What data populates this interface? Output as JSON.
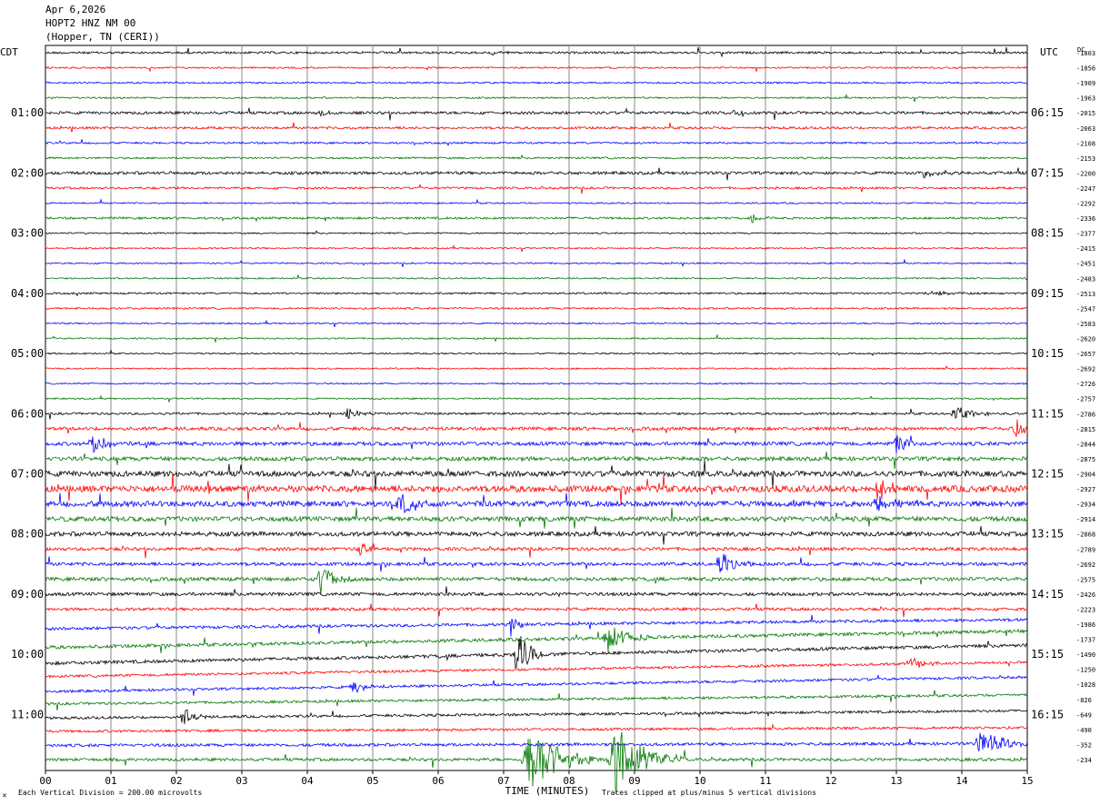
{
  "header": {
    "date": "Apr 6,2026",
    "station": "HOPT2 HNZ NM 00",
    "location": "(Hopper, TN (CERI))"
  },
  "chart_data": {
    "type": "line",
    "title": "",
    "xlabel": "TIME (MINUTES)",
    "ylabel_left": "CDT",
    "ylabel_right": "UTC",
    "dc_label": "DC",
    "x_ticks": [
      "00",
      "01",
      "02",
      "03",
      "04",
      "05",
      "06",
      "07",
      "08",
      "09",
      "10",
      "11",
      "12",
      "13",
      "14",
      "15"
    ],
    "xlim": [
      0,
      15
    ],
    "left_hour_labels": [
      "01:00",
      "02:00",
      "03:00",
      "04:00",
      "05:00",
      "06:00",
      "07:00",
      "08:00",
      "09:00",
      "10:00",
      "11:00"
    ],
    "right_hour_labels": [
      "06:15",
      "07:15",
      "08:15",
      "09:15",
      "10:15",
      "11:15",
      "12:15",
      "13:15",
      "14:15",
      "15:15",
      "16:15"
    ],
    "dc_values": [
      "-1803",
      "-1856",
      "-1909",
      "-1963",
      "-2015",
      "-2063",
      "-2108",
      "-2153",
      "-2200",
      "-2247",
      "-2292",
      "-2336",
      "-2377",
      "-2415",
      "-2451",
      "-2483",
      "-2513",
      "-2547",
      "-2583",
      "-2620",
      "-2657",
      "-2692",
      "-2726",
      "-2757",
      "-2786",
      "-2815",
      "-2844",
      "-2875",
      "-2904",
      "-2927",
      "-2934",
      "-2914",
      "-2868",
      "-2789",
      "-2692",
      "-2575",
      "-2426",
      "-2223",
      "-1986",
      "-1737",
      "-1490",
      "-1250",
      "-1028",
      "-826",
      "-649",
      "-490",
      "-352",
      "-234"
    ],
    "trace_colors": [
      "#000000",
      "#ff0000",
      "#0000ff",
      "#007800"
    ],
    "trace_count": 48,
    "minutes_per_trace": 15,
    "noise_level": [
      1.2,
      0.9,
      0.9,
      0.9,
      1.5,
      1.3,
      1,
      1,
      1.6,
      1.2,
      0.8,
      1.2,
      0.8,
      0.8,
      0.8,
      0.8,
      1,
      1,
      0.8,
      0.8,
      0.8,
      0.8,
      0.8,
      0.8,
      1.2,
      1.8,
      2,
      2.2,
      3,
      3.5,
      3,
      2.6,
      2.4,
      1.8,
      1.8,
      2,
      1.8,
      1.6,
      1.6,
      1.8,
      1.8,
      1.4,
      1.4,
      1.4,
      1.4,
      1.4,
      1.6,
      1.6
    ],
    "drift": [
      0,
      0,
      0,
      0,
      0,
      0,
      0,
      0,
      0,
      0,
      0,
      0,
      0,
      0,
      0,
      0,
      0,
      0,
      0,
      0,
      0,
      0,
      0,
      0,
      0,
      0,
      0,
      0,
      0,
      0,
      0,
      0,
      0,
      0,
      0,
      0,
      0,
      0,
      10,
      18,
      20,
      16,
      16,
      10,
      8,
      4,
      2,
      0
    ],
    "events": [
      {
        "trace": 0,
        "minute": 6.8,
        "amplitude": 4,
        "duration": 0.3
      },
      {
        "trace": 4,
        "minute": 4.2,
        "amplitude": 8,
        "duration": 0.15
      },
      {
        "trace": 4,
        "minute": 10.5,
        "amplitude": 4,
        "duration": 0.3
      },
      {
        "trace": 8,
        "minute": 13.4,
        "amplitude": 5,
        "duration": 0.6
      },
      {
        "trace": 11,
        "minute": 10.8,
        "amplitude": 6,
        "duration": 0.3
      },
      {
        "trace": 16,
        "minute": 13.5,
        "amplitude": 4,
        "duration": 0.5
      },
      {
        "trace": 24,
        "minute": 4.6,
        "amplitude": 8,
        "duration": 0.4
      },
      {
        "trace": 24,
        "minute": 13.9,
        "amplitude": 10,
        "duration": 0.5
      },
      {
        "trace": 25,
        "minute": 14.8,
        "amplitude": 14,
        "duration": 0.3
      },
      {
        "trace": 26,
        "minute": 0.7,
        "amplitude": 12,
        "duration": 0.5
      },
      {
        "trace": 26,
        "minute": 13.0,
        "amplitude": 10,
        "duration": 0.4
      },
      {
        "trace": 29,
        "minute": 12.7,
        "amplitude": 16,
        "duration": 0.3
      },
      {
        "trace": 30,
        "minute": 5.4,
        "amplitude": 14,
        "duration": 0.4
      },
      {
        "trace": 30,
        "minute": 12.7,
        "amplitude": 12,
        "duration": 0.4
      },
      {
        "trace": 33,
        "minute": 4.8,
        "amplitude": 10,
        "duration": 0.3
      },
      {
        "trace": 34,
        "minute": 10.3,
        "amplitude": 14,
        "duration": 0.4
      },
      {
        "trace": 35,
        "minute": 4.2,
        "amplitude": 16,
        "duration": 0.5
      },
      {
        "trace": 38,
        "minute": 7.1,
        "amplitude": 14,
        "duration": 0.2
      },
      {
        "trace": 39,
        "minute": 8.6,
        "amplitude": 18,
        "duration": 0.6
      },
      {
        "trace": 40,
        "minute": 7.2,
        "amplitude": 26,
        "duration": 0.5
      },
      {
        "trace": 41,
        "minute": 13.2,
        "amplitude": 8,
        "duration": 0.4
      },
      {
        "trace": 42,
        "minute": 4.7,
        "amplitude": 8,
        "duration": 0.4
      },
      {
        "trace": 44,
        "minute": 2.1,
        "amplitude": 12,
        "duration": 0.3
      },
      {
        "trace": 46,
        "minute": 14.3,
        "amplitude": 14,
        "duration": 0.8
      },
      {
        "trace": 47,
        "minute": 7.4,
        "amplitude": 40,
        "duration": 0.9
      },
      {
        "trace": 47,
        "minute": 8.7,
        "amplitude": 40,
        "duration": 0.9
      }
    ]
  },
  "footer": {
    "scale_note": "Each Vertical Division =  200.00 microvolts",
    "clip_note": "Traces clipped at plus/minus 5 vertical divisions",
    "corner_mark": "✕"
  }
}
